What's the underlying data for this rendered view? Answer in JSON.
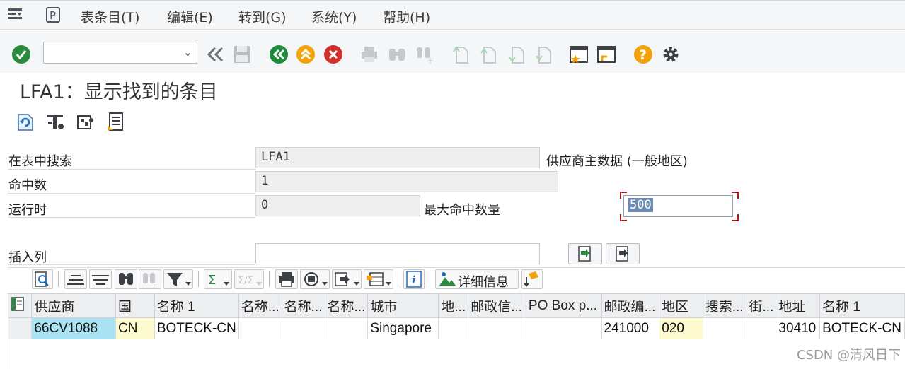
{
  "menu": {
    "items": [
      "表条目(T)",
      "编辑(E)",
      "转到(G)",
      "系统(Y)",
      "帮助(H)"
    ]
  },
  "toolbar": {
    "command_value": "",
    "icons": [
      "enter-icon",
      "back-double-icon",
      "save-icon",
      "back-icon",
      "exit-icon",
      "cancel-icon",
      "print-icon",
      "find-icon",
      "find-next-icon",
      "first-page-icon",
      "prev-page-icon",
      "next-page-icon",
      "last-page-icon",
      "create-session-icon",
      "shortcut-icon",
      "help-icon",
      "settings-icon"
    ]
  },
  "page": {
    "title": "LFA1：显示找到的条目"
  },
  "app_toolbar": {
    "icons": [
      "refresh-icon",
      "settings-display-icon",
      "puzzle-icon",
      "document-icon"
    ]
  },
  "form": {
    "search_table_label": "在表中搜索",
    "search_table_value": "LFA1",
    "search_table_desc": "供应商主数据 (一般地区)",
    "hits_label": "命中数",
    "hits_value": "1",
    "runtime_label": "运行时",
    "runtime_value": "0",
    "max_hits_label": "最大命中数量",
    "max_hits_value": "500",
    "insert_col_label": "插入列",
    "insert_col_value": ""
  },
  "grid_toolbar": {
    "detail_label": "详细信息"
  },
  "table": {
    "columns": [
      "供应商",
      "国",
      "名称 1",
      "名称...",
      "名称...",
      "名称...",
      "城市",
      "地...",
      "邮政信...",
      "PO Box p...",
      "邮政编...",
      "地区",
      "搜索...",
      "街...",
      "地址",
      "名称 1"
    ],
    "rows": [
      [
        "66CV1088",
        "CN",
        "BOTECK-CN",
        "",
        "",
        "",
        "Singapore",
        "",
        "",
        "",
        "241000",
        "020",
        "",
        "",
        "30410",
        "BOTECK-CN"
      ]
    ]
  },
  "watermark": "CSDN @清风日下",
  "colors": {
    "key_cell": "#a9e2f3",
    "highlight_cell": "#fffbd0",
    "enter_green": "#2b8a3e",
    "back_green": "#1f8c3b",
    "exit_yellow": "#f0a30a",
    "cancel_red": "#d32f2f",
    "help_yellow": "#f0a30a"
  }
}
